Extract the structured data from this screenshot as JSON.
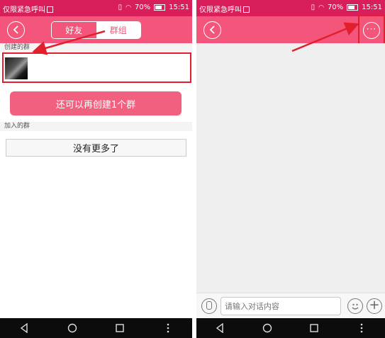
{
  "left_screen": {
    "statusbar": {
      "carrier": "仅限紧急呼叫",
      "battery": "70%",
      "time": "15:51"
    },
    "tabs": {
      "friends": "好友",
      "groups": "群组"
    },
    "created_section": "创建的群",
    "create_button": "还可以再创建1个群",
    "joined_section": "加入的群",
    "no_more": "没有更多了"
  },
  "right_screen": {
    "statusbar": {
      "carrier": "仅限紧急呼叫",
      "battery": "70%",
      "time": "15:51"
    },
    "input_placeholder": "请输入对话内容",
    "more_icon": "···"
  },
  "colors": {
    "appbar": "#f4557b",
    "statusbar": "#d81e5b",
    "highlight": "#e21f2d"
  }
}
